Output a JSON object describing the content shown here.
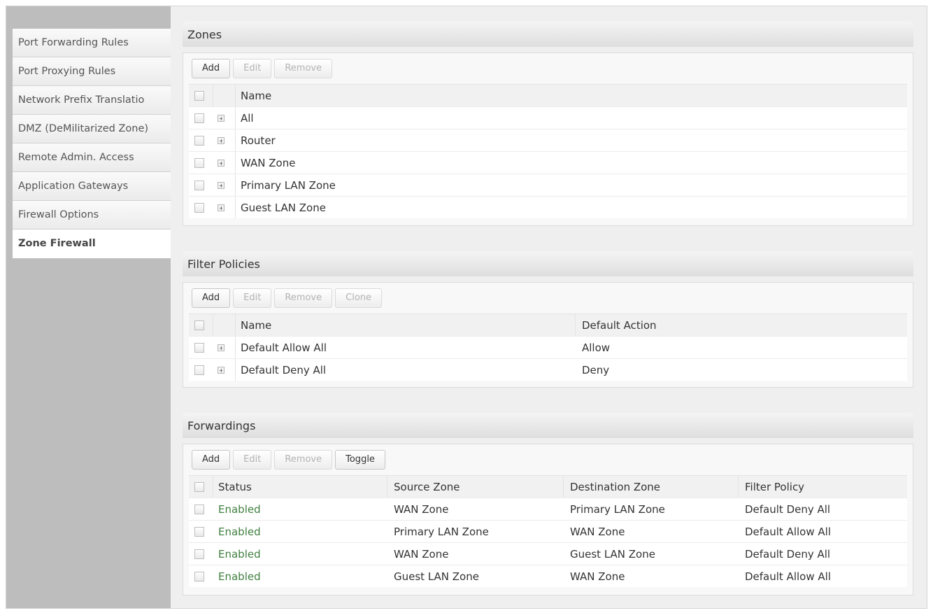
{
  "sidebar": {
    "items": [
      {
        "label": "Port Forwarding Rules"
      },
      {
        "label": "Port Proxying Rules"
      },
      {
        "label": "Network Prefix Translatio"
      },
      {
        "label": "DMZ (DeMilitarized Zone)"
      },
      {
        "label": "Remote Admin. Access"
      },
      {
        "label": "Application Gateways"
      },
      {
        "label": "Firewall Options"
      },
      {
        "label": "Zone Firewall"
      }
    ],
    "active_index": 7
  },
  "zones": {
    "title": "Zones",
    "buttons": {
      "add": "Add",
      "edit": "Edit",
      "remove": "Remove"
    },
    "header": {
      "name": "Name"
    },
    "rows": [
      {
        "name": "All"
      },
      {
        "name": "Router"
      },
      {
        "name": "WAN Zone"
      },
      {
        "name": "Primary LAN Zone"
      },
      {
        "name": "Guest LAN Zone"
      }
    ]
  },
  "filter_policies": {
    "title": "Filter Policies",
    "buttons": {
      "add": "Add",
      "edit": "Edit",
      "remove": "Remove",
      "clone": "Clone"
    },
    "header": {
      "name": "Name",
      "default_action": "Default Action"
    },
    "rows": [
      {
        "name": "Default Allow All",
        "default_action": "Allow"
      },
      {
        "name": "Default Deny All",
        "default_action": "Deny"
      }
    ]
  },
  "forwardings": {
    "title": "Forwardings",
    "buttons": {
      "add": "Add",
      "edit": "Edit",
      "remove": "Remove",
      "toggle": "Toggle"
    },
    "header": {
      "status": "Status",
      "source_zone": "Source Zone",
      "destination_zone": "Destination Zone",
      "filter_policy": "Filter Policy"
    },
    "rows": [
      {
        "status": "Enabled",
        "source_zone": "WAN Zone",
        "destination_zone": "Primary LAN Zone",
        "filter_policy": "Default Deny All"
      },
      {
        "status": "Enabled",
        "source_zone": "Primary LAN Zone",
        "destination_zone": "WAN Zone",
        "filter_policy": "Default Allow All"
      },
      {
        "status": "Enabled",
        "source_zone": "WAN Zone",
        "destination_zone": "Guest LAN Zone",
        "filter_policy": "Default Deny All"
      },
      {
        "status": "Enabled",
        "source_zone": "Guest LAN Zone",
        "destination_zone": "WAN Zone",
        "filter_policy": "Default Allow All"
      }
    ]
  },
  "colors": {
    "status_enabled": "#3f7f3f",
    "sidebar_bg": "#bdbdbd"
  }
}
